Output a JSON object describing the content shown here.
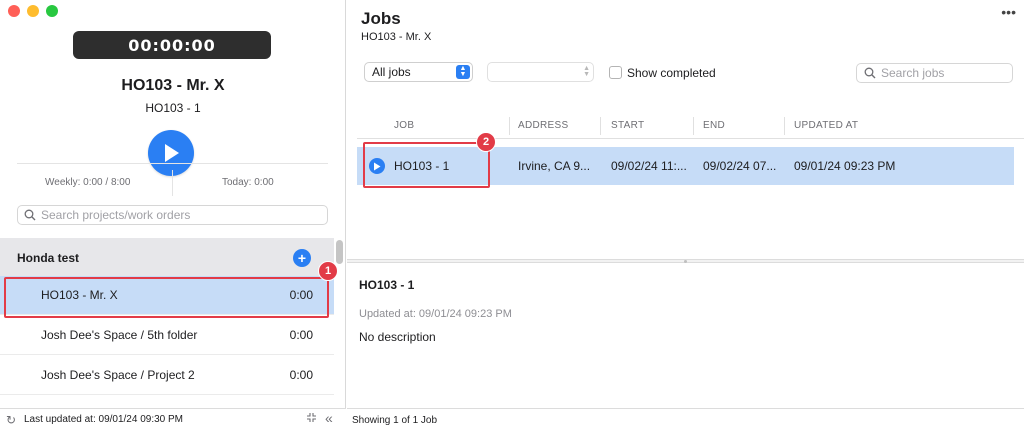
{
  "window": {
    "controls": [
      "close",
      "minimize",
      "zoom"
    ]
  },
  "sidebar": {
    "timer": "00:00:00",
    "project_title": "HO103 - Mr. X",
    "project_subtitle": "HO103 - 1",
    "weekly": "Weekly: 0:00 / 8:00",
    "today": "Today: 0:00",
    "search_placeholder": "Search projects/work orders",
    "group": {
      "title": "Honda test",
      "add_icon": "plus-icon"
    },
    "items": [
      {
        "label": "HO103 - Mr. X",
        "time": "0:00",
        "selected": true
      },
      {
        "label": "Josh Dee's Space / 5th folder",
        "time": "0:00",
        "selected": false
      },
      {
        "label": "Josh Dee's Space / Project 2",
        "time": "0:00",
        "selected": false
      }
    ],
    "footer": {
      "last_updated": "Last updated at: 09/01/24 09:30 PM"
    }
  },
  "annotations": {
    "badge_1": "1",
    "badge_2": "2",
    "color": "#e23b47"
  },
  "main": {
    "title": "Jobs",
    "subtitle": "HO103 - Mr. X",
    "filter_selected": "All jobs",
    "secondary_filter": "",
    "show_completed_label": "Show completed",
    "show_completed_checked": false,
    "search_placeholder": "Search jobs",
    "columns": [
      "JOB",
      "ADDRESS",
      "START",
      "END",
      "UPDATED AT"
    ],
    "rows": [
      {
        "job": "HO103 - 1",
        "address": "Irvine, CA 9...",
        "start": "09/02/24 11:...",
        "end": "09/02/24 07...",
        "updated_at": "09/01/24 09:23 PM"
      }
    ],
    "detail": {
      "title": "HO103 - 1",
      "updated": "Updated at: 09/01/24 09:23 PM",
      "description": "No description"
    },
    "footer": {
      "count": "Showing 1 of 1 Job"
    }
  },
  "colors": {
    "accent": "#2a7ff3",
    "selection": "#c6dcf7",
    "timer_bg": "#2e2e2e"
  }
}
